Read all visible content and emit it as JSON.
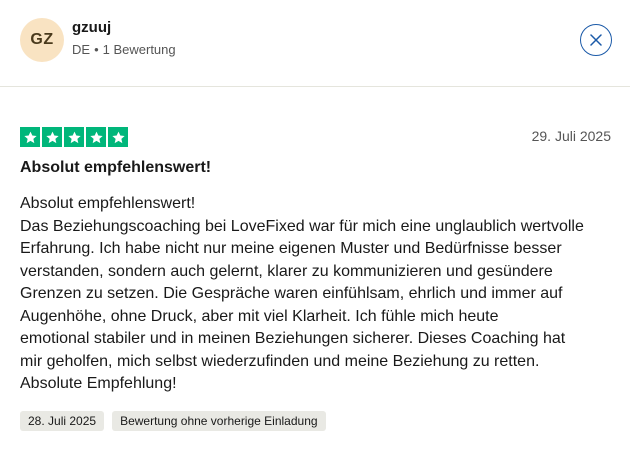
{
  "user": {
    "initials": "GZ",
    "name": "gzuuj",
    "country": "DE",
    "separator": "•",
    "review_count": "1 Bewertung"
  },
  "close_icon": "close-icon",
  "review": {
    "rating": 5,
    "max_rating": 5,
    "star_color": "#00b67a",
    "date": "29. Juli 2025",
    "title": "Absolut empfehlenswert!",
    "body_lines": [
      "Absolut empfehlenswert!",
      "Das Beziehungscoaching bei LoveFixed war für mich eine unglaublich wertvolle",
      "Erfahrung. Ich habe nicht nur meine eigenen Muster und Bedürfnisse besser",
      "verstanden, sondern auch gelernt, klarer zu kommunizieren und gesündere",
      "Grenzen zu setzen. Die Gespräche waren einfühlsam, ehrlich und immer auf",
      "Augenhöhe, ohne Druck, aber mit viel Klarheit. Ich fühle mich heute",
      "emotional stabiler und in meinen Beziehungen sicherer. Dieses Coaching hat",
      "mir geholfen, mich selbst wiederzufinden und meine Beziehung zu retten.",
      "Absolute Empfehlung!"
    ],
    "tags": {
      "experience_date": "28. Juli 2025",
      "invitation": "Bewertung ohne vorherige Einladung"
    }
  },
  "colors": {
    "avatar_bg": "#f9e3c2",
    "close_border": "#1b5aa8",
    "tag_bg": "#e9e9e4"
  }
}
